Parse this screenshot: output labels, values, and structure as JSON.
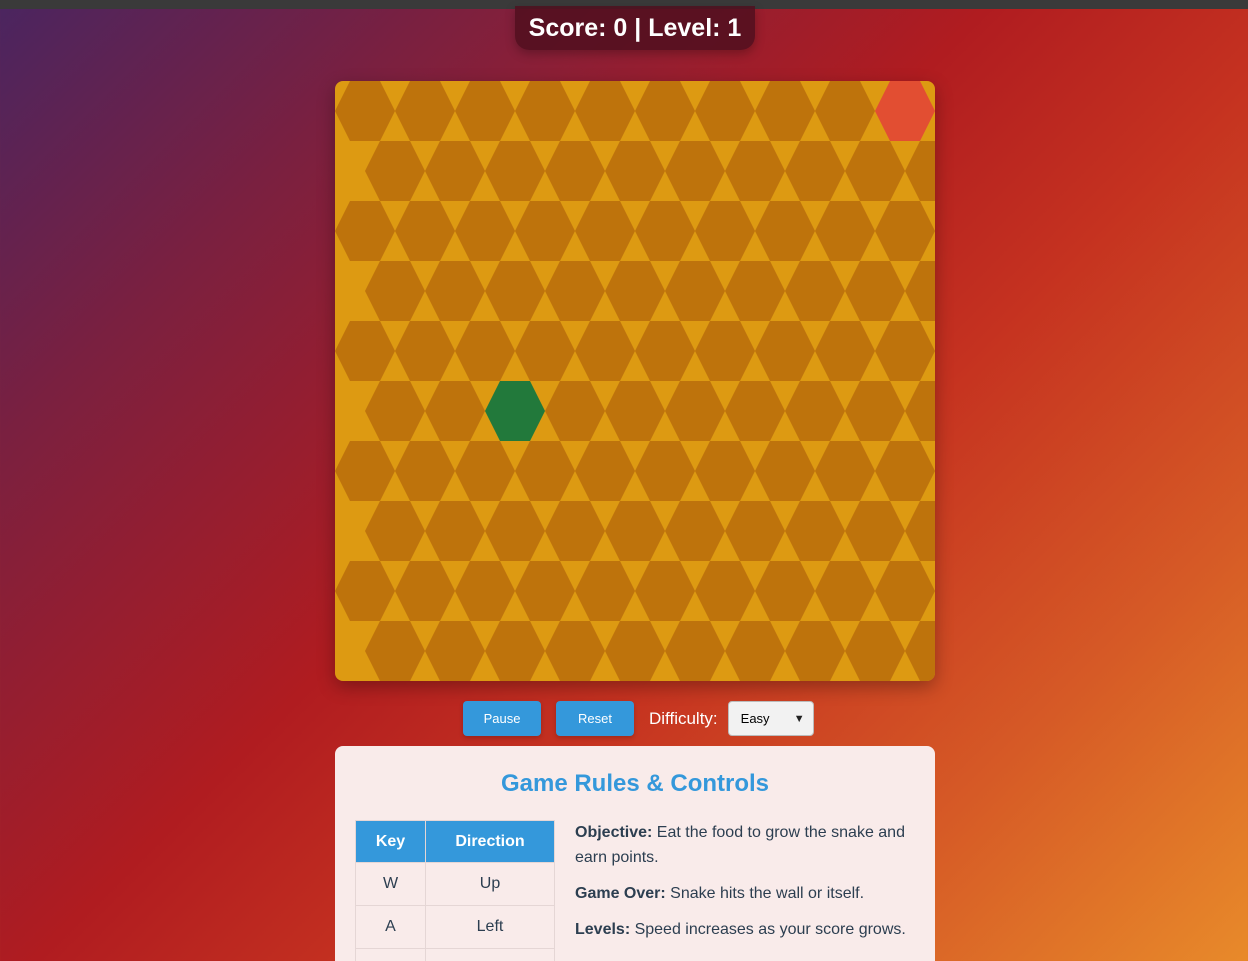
{
  "score_label": "Score: 0 | Level: 1",
  "board": {
    "cols": 10,
    "rows": 10,
    "snake": [
      {
        "col": 2,
        "row": 5
      }
    ],
    "food": {
      "col": 9,
      "row": 0
    },
    "colors": {
      "background": "#dd9a12",
      "cell": "#b96c0c",
      "snake": "#17773e",
      "food": "#e24a35"
    }
  },
  "controls": {
    "pause_label": "Pause",
    "reset_label": "Reset",
    "difficulty_label": "Difficulty:",
    "difficulty_value": "Easy"
  },
  "rules": {
    "title": "Game Rules & Controls",
    "table_headers": [
      "Key",
      "Direction"
    ],
    "table_rows": [
      [
        "W",
        "Up"
      ],
      [
        "A",
        "Left"
      ]
    ],
    "items": [
      {
        "label": "Objective:",
        "text": " Eat the food to grow the snake and earn points."
      },
      {
        "label": "Game Over:",
        "text": " Snake hits the wall or itself."
      },
      {
        "label": "Levels:",
        "text": " Speed increases as your score grows."
      }
    ]
  },
  "accent_color": "#3498db"
}
